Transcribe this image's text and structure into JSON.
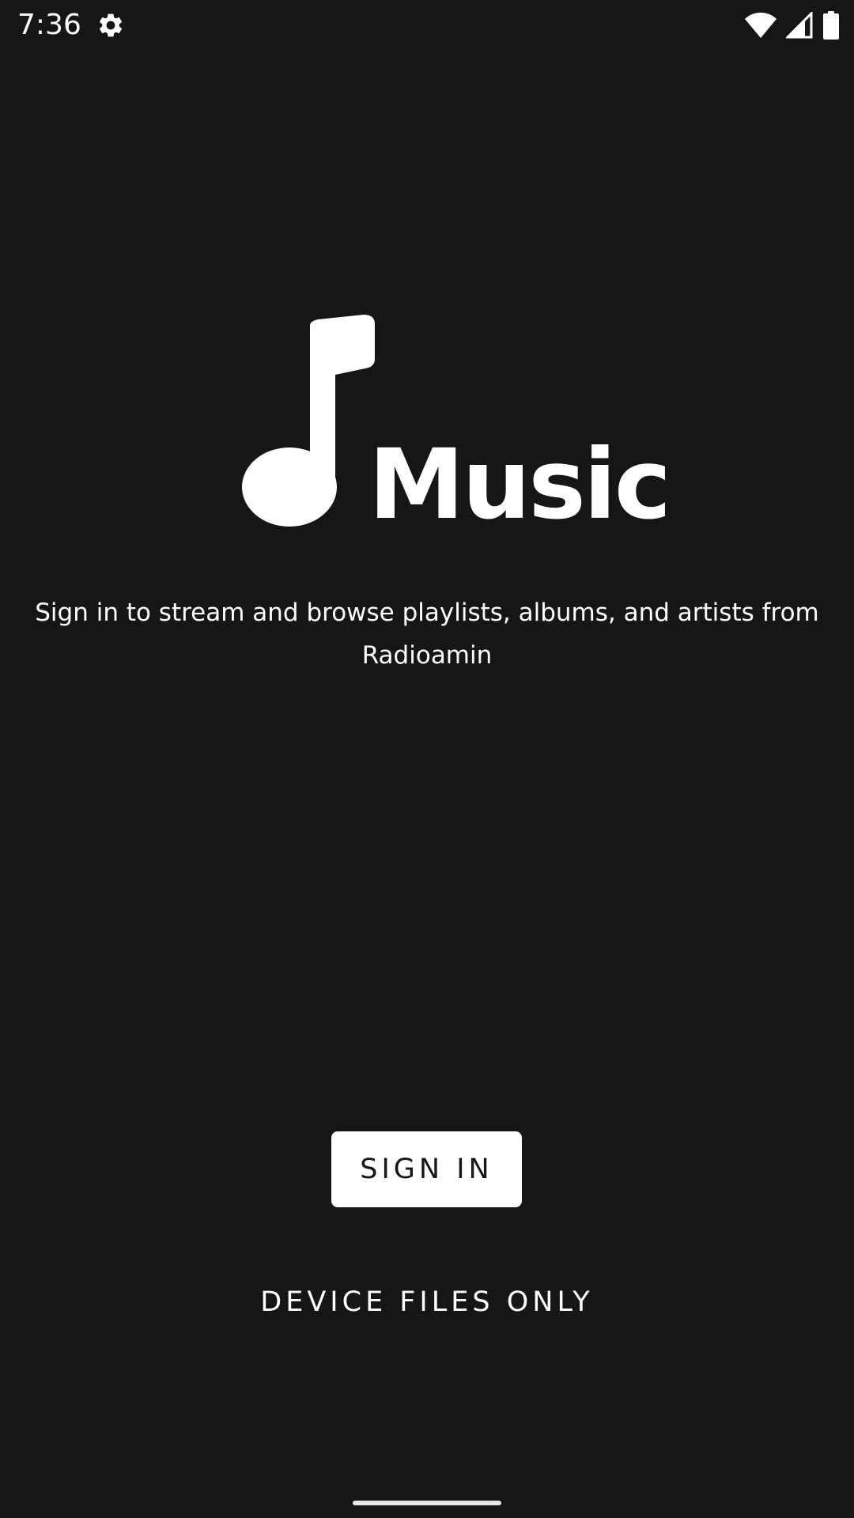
{
  "status_bar": {
    "time": "7:36",
    "icons": [
      "settings-gear-icon",
      "wifi-icon",
      "cellular-signal-icon",
      "battery-icon"
    ]
  },
  "logo": {
    "icon": "music-note-icon",
    "wordmark": "Music"
  },
  "tagline": "Sign in to stream and browse playlists, albums, and artists from Radioamin",
  "actions": {
    "sign_in_label": "SIGN IN",
    "device_files_label": "DEVICE FILES ONLY"
  },
  "colors": {
    "background": "#161616",
    "foreground": "#ffffff",
    "primary_button_bg": "#ffffff",
    "primary_button_text": "#161616"
  }
}
